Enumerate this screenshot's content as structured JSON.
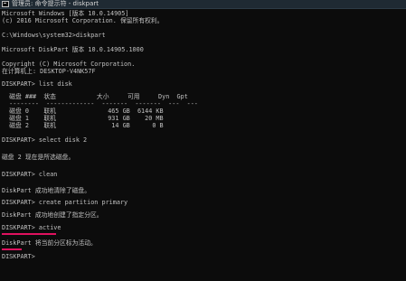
{
  "window": {
    "title": "管理员: 命令提示符 - diskpart"
  },
  "console": {
    "lines": [
      "Microsoft Windows [版本 10.0.14905]",
      "(c) 2016 Microsoft Corporation. 保留所有权利。",
      "",
      "C:\\Windows\\system32>diskpart",
      "",
      "Microsoft DiskPart 版本 10.0.14905.1000",
      "",
      "Copyright (C) Microsoft Corporation.",
      "在计算机上: DESKTOP-V4NK57F",
      "",
      "DISKPART> list disk",
      "",
      "  磁盘 ###  状态           大小     可用     Dyn  Gpt",
      "  --------  -------------  -------  -------  ---  ---",
      "  磁盘 0    联机              465 GB  6144 KB",
      "  磁盘 1    联机              931 GB    20 MB",
      "  磁盘 2    联机               14 GB      0 B",
      "",
      "DISKPART> select disk 2",
      "",
      "磁盘 2 现在是所选磁盘。",
      "",
      "DISKPART> clean",
      "",
      "DiskPart 成功地清除了磁盘。",
      "",
      "DISKPART> create partition primary",
      "",
      "DiskPart 成功地创建了指定分区。",
      "",
      "DISKPART> active",
      "",
      "DiskPart 将当前分区标为活动。",
      "",
      "DISKPART>"
    ]
  }
}
